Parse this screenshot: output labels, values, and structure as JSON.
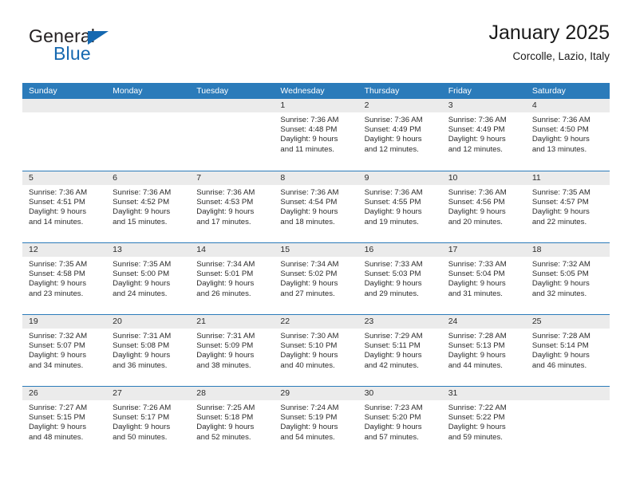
{
  "brand": {
    "name_part1": "General",
    "name_part2": "Blue",
    "triangle_icon": "blue-triangle-icon",
    "color_dark": "#231f20",
    "color_blue": "#1568b0"
  },
  "header": {
    "title": "January 2025",
    "subtitle": "Corcolle, Lazio, Italy"
  },
  "calendar": {
    "header_bg": "#2b7bba",
    "daynum_bg": "#ebebeb",
    "weekday_names": [
      "Sunday",
      "Monday",
      "Tuesday",
      "Wednesday",
      "Thursday",
      "Friday",
      "Saturday"
    ],
    "weeks": [
      [
        {
          "day": "",
          "lines": []
        },
        {
          "day": "",
          "lines": []
        },
        {
          "day": "",
          "lines": []
        },
        {
          "day": "1",
          "lines": [
            "Sunrise: 7:36 AM",
            "Sunset: 4:48 PM",
            "Daylight: 9 hours",
            "and 11 minutes."
          ]
        },
        {
          "day": "2",
          "lines": [
            "Sunrise: 7:36 AM",
            "Sunset: 4:49 PM",
            "Daylight: 9 hours",
            "and 12 minutes."
          ]
        },
        {
          "day": "3",
          "lines": [
            "Sunrise: 7:36 AM",
            "Sunset: 4:49 PM",
            "Daylight: 9 hours",
            "and 12 minutes."
          ]
        },
        {
          "day": "4",
          "lines": [
            "Sunrise: 7:36 AM",
            "Sunset: 4:50 PM",
            "Daylight: 9 hours",
            "and 13 minutes."
          ]
        }
      ],
      [
        {
          "day": "5",
          "lines": [
            "Sunrise: 7:36 AM",
            "Sunset: 4:51 PM",
            "Daylight: 9 hours",
            "and 14 minutes."
          ]
        },
        {
          "day": "6",
          "lines": [
            "Sunrise: 7:36 AM",
            "Sunset: 4:52 PM",
            "Daylight: 9 hours",
            "and 15 minutes."
          ]
        },
        {
          "day": "7",
          "lines": [
            "Sunrise: 7:36 AM",
            "Sunset: 4:53 PM",
            "Daylight: 9 hours",
            "and 17 minutes."
          ]
        },
        {
          "day": "8",
          "lines": [
            "Sunrise: 7:36 AM",
            "Sunset: 4:54 PM",
            "Daylight: 9 hours",
            "and 18 minutes."
          ]
        },
        {
          "day": "9",
          "lines": [
            "Sunrise: 7:36 AM",
            "Sunset: 4:55 PM",
            "Daylight: 9 hours",
            "and 19 minutes."
          ]
        },
        {
          "day": "10",
          "lines": [
            "Sunrise: 7:36 AM",
            "Sunset: 4:56 PM",
            "Daylight: 9 hours",
            "and 20 minutes."
          ]
        },
        {
          "day": "11",
          "lines": [
            "Sunrise: 7:35 AM",
            "Sunset: 4:57 PM",
            "Daylight: 9 hours",
            "and 22 minutes."
          ]
        }
      ],
      [
        {
          "day": "12",
          "lines": [
            "Sunrise: 7:35 AM",
            "Sunset: 4:58 PM",
            "Daylight: 9 hours",
            "and 23 minutes."
          ]
        },
        {
          "day": "13",
          "lines": [
            "Sunrise: 7:35 AM",
            "Sunset: 5:00 PM",
            "Daylight: 9 hours",
            "and 24 minutes."
          ]
        },
        {
          "day": "14",
          "lines": [
            "Sunrise: 7:34 AM",
            "Sunset: 5:01 PM",
            "Daylight: 9 hours",
            "and 26 minutes."
          ]
        },
        {
          "day": "15",
          "lines": [
            "Sunrise: 7:34 AM",
            "Sunset: 5:02 PM",
            "Daylight: 9 hours",
            "and 27 minutes."
          ]
        },
        {
          "day": "16",
          "lines": [
            "Sunrise: 7:33 AM",
            "Sunset: 5:03 PM",
            "Daylight: 9 hours",
            "and 29 minutes."
          ]
        },
        {
          "day": "17",
          "lines": [
            "Sunrise: 7:33 AM",
            "Sunset: 5:04 PM",
            "Daylight: 9 hours",
            "and 31 minutes."
          ]
        },
        {
          "day": "18",
          "lines": [
            "Sunrise: 7:32 AM",
            "Sunset: 5:05 PM",
            "Daylight: 9 hours",
            "and 32 minutes."
          ]
        }
      ],
      [
        {
          "day": "19",
          "lines": [
            "Sunrise: 7:32 AM",
            "Sunset: 5:07 PM",
            "Daylight: 9 hours",
            "and 34 minutes."
          ]
        },
        {
          "day": "20",
          "lines": [
            "Sunrise: 7:31 AM",
            "Sunset: 5:08 PM",
            "Daylight: 9 hours",
            "and 36 minutes."
          ]
        },
        {
          "day": "21",
          "lines": [
            "Sunrise: 7:31 AM",
            "Sunset: 5:09 PM",
            "Daylight: 9 hours",
            "and 38 minutes."
          ]
        },
        {
          "day": "22",
          "lines": [
            "Sunrise: 7:30 AM",
            "Sunset: 5:10 PM",
            "Daylight: 9 hours",
            "and 40 minutes."
          ]
        },
        {
          "day": "23",
          "lines": [
            "Sunrise: 7:29 AM",
            "Sunset: 5:11 PM",
            "Daylight: 9 hours",
            "and 42 minutes."
          ]
        },
        {
          "day": "24",
          "lines": [
            "Sunrise: 7:28 AM",
            "Sunset: 5:13 PM",
            "Daylight: 9 hours",
            "and 44 minutes."
          ]
        },
        {
          "day": "25",
          "lines": [
            "Sunrise: 7:28 AM",
            "Sunset: 5:14 PM",
            "Daylight: 9 hours",
            "and 46 minutes."
          ]
        }
      ],
      [
        {
          "day": "26",
          "lines": [
            "Sunrise: 7:27 AM",
            "Sunset: 5:15 PM",
            "Daylight: 9 hours",
            "and 48 minutes."
          ]
        },
        {
          "day": "27",
          "lines": [
            "Sunrise: 7:26 AM",
            "Sunset: 5:17 PM",
            "Daylight: 9 hours",
            "and 50 minutes."
          ]
        },
        {
          "day": "28",
          "lines": [
            "Sunrise: 7:25 AM",
            "Sunset: 5:18 PM",
            "Daylight: 9 hours",
            "and 52 minutes."
          ]
        },
        {
          "day": "29",
          "lines": [
            "Sunrise: 7:24 AM",
            "Sunset: 5:19 PM",
            "Daylight: 9 hours",
            "and 54 minutes."
          ]
        },
        {
          "day": "30",
          "lines": [
            "Sunrise: 7:23 AM",
            "Sunset: 5:20 PM",
            "Daylight: 9 hours",
            "and 57 minutes."
          ]
        },
        {
          "day": "31",
          "lines": [
            "Sunrise: 7:22 AM",
            "Sunset: 5:22 PM",
            "Daylight: 9 hours",
            "and 59 minutes."
          ]
        },
        {
          "day": "",
          "lines": []
        }
      ]
    ]
  }
}
